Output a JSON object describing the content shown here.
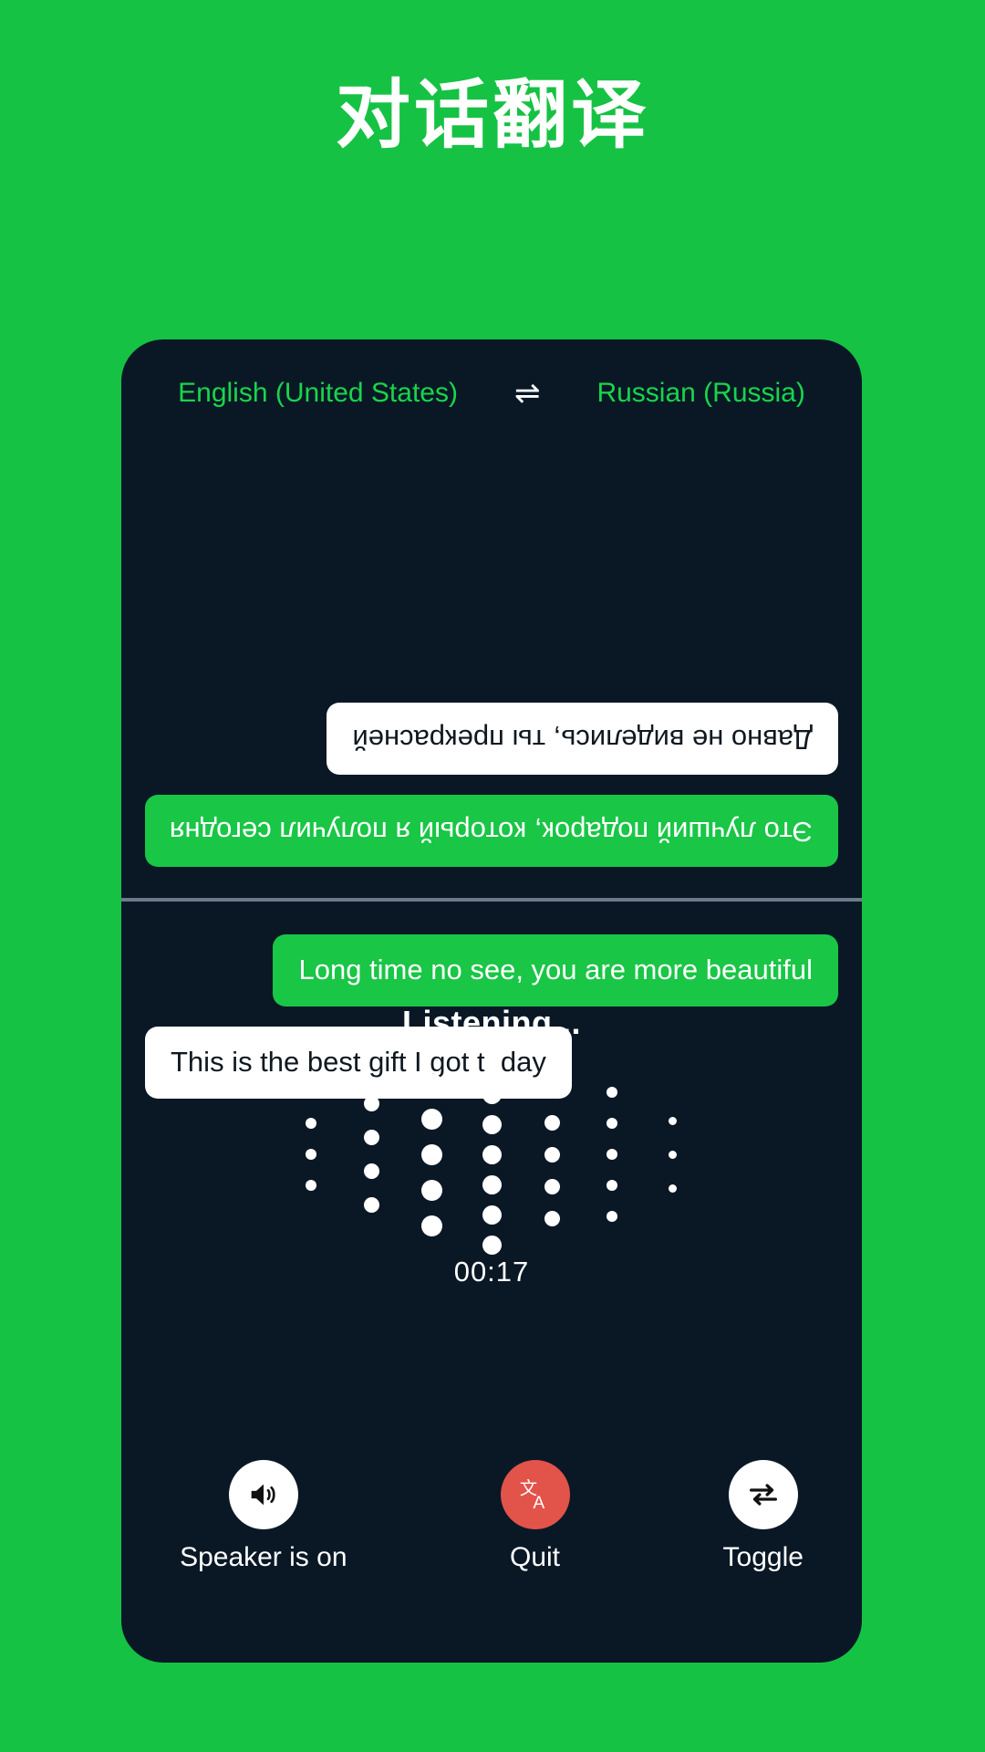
{
  "page": {
    "title": "对话翻译",
    "background_color": "#16C244",
    "panel_color": "#0A1826"
  },
  "language_bar": {
    "source_language": "English (United States)",
    "swap_icon": "swap-horizontal-icon",
    "swap_glyph": "⇌",
    "target_language": "Russian (Russia)",
    "text_color": "#19D54A"
  },
  "conversation": {
    "remote_messages": [
      {
        "text": "Это лучший подарок, который я получил сегодня",
        "style": "green",
        "align": "right"
      },
      {
        "text": "Давно не виделись, ты прекрасней",
        "style": "white",
        "align": "left"
      }
    ],
    "local_messages": [
      {
        "text": "Long time no see, you are more beautiful",
        "style": "green",
        "align": "right"
      },
      {
        "text": "This is the best gift I got today",
        "style": "white",
        "align": "left"
      }
    ],
    "bubble_green_color": "#19C646",
    "bubble_white_color": "#FFFFFF"
  },
  "status": {
    "listening_label": "Listening...",
    "timer": "00:17"
  },
  "waveform": {
    "dot_color": "#FFFFFF",
    "columns": [
      {
        "count": 3,
        "size": 12,
        "gap": 22
      },
      {
        "count": 4,
        "size": 17,
        "gap": 20
      },
      {
        "count": 5,
        "size": 23,
        "gap": 16
      },
      {
        "count": 7,
        "size": 21,
        "gap": 12
      },
      {
        "count": 5,
        "size": 17,
        "gap": 18
      },
      {
        "count": 5,
        "size": 12,
        "gap": 22
      },
      {
        "count": 3,
        "size": 9,
        "gap": 28
      }
    ]
  },
  "controls": [
    {
      "label": "Speaker is on",
      "icon": "speaker-on-icon",
      "style": "light"
    },
    {
      "label": "Quit",
      "icon": "translate-icon",
      "style": "danger",
      "color": "#E2534A"
    },
    {
      "label": "Toggle",
      "icon": "swap-arrows-icon",
      "style": "light"
    }
  ]
}
